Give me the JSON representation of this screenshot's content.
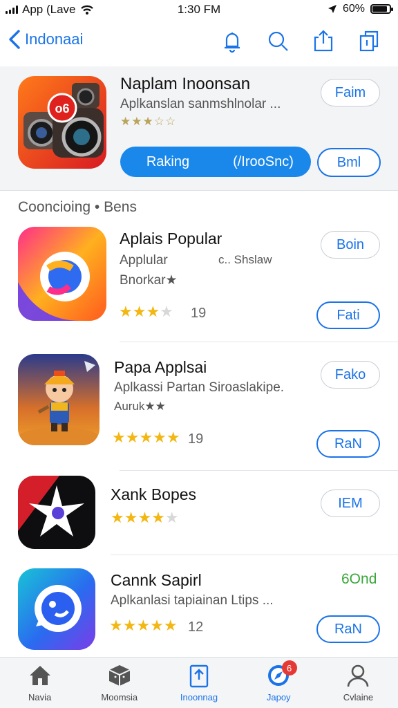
{
  "status": {
    "carrier": "App (Lave",
    "time": "1:30 FM",
    "battery": "60%"
  },
  "nav": {
    "back_label": "Indonaai"
  },
  "featured": {
    "title": "Naplam Inoonsan",
    "subtitle": "Aplkanslan sanmshlnolar ...",
    "rating_stars": "★★★☆☆",
    "button_label": "Faim",
    "segment": [
      "Raking",
      "(/IrooSnc)"
    ],
    "secondary_button": "Bml"
  },
  "section_title": "Cooncioing • Bens",
  "apps": [
    {
      "name": "Aplais Popular",
      "line1": "Applular",
      "line1b": "c.. Shslaw",
      "line2": "Bnorkar★",
      "stars_full": "★★★",
      "stars_half": "★",
      "stars_empty": "",
      "rating_count": "19",
      "top_button": "Boin",
      "bottom_button": "Fati",
      "rating": 3.5
    },
    {
      "name": "Papa Applsai",
      "line1": "Aplkassi Partan Siroaslakipe.",
      "line1b": "",
      "line2": "Auruk★★",
      "stars_full": "★★★★★",
      "stars_half": "",
      "stars_empty": "",
      "rating_count": "19",
      "top_button": "Fako",
      "bottom_button": "RaN",
      "rating": 5
    },
    {
      "name": "Xank Bopes",
      "line1": "",
      "line1b": "",
      "line2": "",
      "stars_full": "★★★★",
      "stars_half": "★",
      "stars_empty": "",
      "rating_count": "",
      "top_button": "IEM",
      "bottom_button": "",
      "rating": 4.5
    },
    {
      "name": "Cannk Sapirl",
      "line1": "Aplkanlasi tapiainan Ltips ...",
      "line1b": "",
      "line2": "",
      "stars_full": "★★★★★",
      "stars_half": "",
      "stars_empty": "",
      "rating_count": "12",
      "top_button": "6Ond",
      "bottom_button": "RaN",
      "rating": 5
    }
  ],
  "tabs": [
    {
      "label": "Navia",
      "icon": "home-icon"
    },
    {
      "label": "Moomsia",
      "icon": "box-icon"
    },
    {
      "label": "Inoonnag",
      "icon": "share-icon"
    },
    {
      "label": "Japoy",
      "icon": "compass-icon",
      "badge": "6"
    },
    {
      "label": "Cvlaine",
      "icon": "person-icon"
    }
  ],
  "colors": {
    "accent": "#1a73e8",
    "star": "#f3b713",
    "green_label": "#3aa63a"
  }
}
